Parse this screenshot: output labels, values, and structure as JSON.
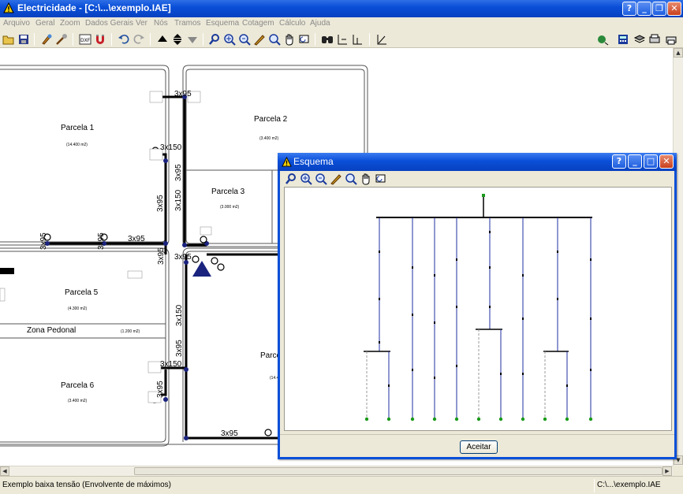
{
  "window": {
    "title": "Electricidade - [C:\\...\\exemplo.IAE]",
    "help_label": "?",
    "minimize_label": "_",
    "restore_label": "❐",
    "close_label": "✕"
  },
  "menu": {
    "items": [
      "Arquivo",
      "Geral",
      "Zoom",
      "Dados Gerais",
      "Ver",
      "Nós",
      "Tramos",
      "Esquema",
      "Cotagem",
      "Cálculo",
      "Ajuda"
    ]
  },
  "plan": {
    "parcels": [
      {
        "name": "Parcela 1",
        "area": "(14.400 m2)"
      },
      {
        "name": "Parcela 2",
        "area": "(3.400 m2)"
      },
      {
        "name": "Parcela 3",
        "area": "(3.000 m2)"
      },
      {
        "name": "Parcela 5",
        "area": "(4.300 m2)"
      },
      {
        "name": "Zona Pedonal",
        "area": "(1.200 m2)"
      },
      {
        "name": "Parcela 6",
        "area": "(3.400 m2)"
      },
      {
        "name": "Parce",
        "area": "(14.4"
      }
    ],
    "cables": {
      "c1": "3x95",
      "c2": "3x150",
      "c3": "3x95",
      "c4": "3x150",
      "c5": "3x95",
      "c6": "3x95",
      "c7": "3x95",
      "c8": "3x95",
      "c9": "3x95",
      "c10": "3x150",
      "c11": "3x95",
      "c12": "3x150",
      "c13": "3x95",
      "c14": "3x95",
      "c15": "3x95"
    },
    "colors": {
      "cable": "#000000",
      "node": "#1a237e"
    }
  },
  "dialog": {
    "title": "Esquema",
    "help_label": "?",
    "minimize_label": "_",
    "maximize_label": "□",
    "close_label": "✕",
    "accept_label": "Aceitar",
    "colors": {
      "line": "#1f2fa0",
      "node": "#1a9a1a",
      "source": "#1a9a1a"
    }
  },
  "status": {
    "left": "Exemplo baixa tensão (Envolvente de máximos)",
    "right": "C:\\...\\exemplo.IAE"
  }
}
